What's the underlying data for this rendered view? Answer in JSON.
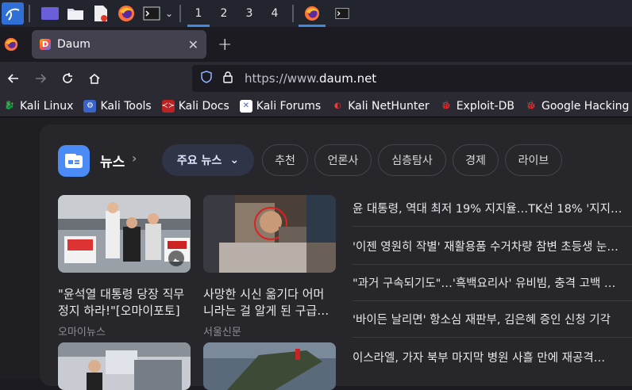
{
  "panel": {
    "workspaces": [
      "1",
      "2",
      "3",
      "4"
    ],
    "active_workspace": "1"
  },
  "browser": {
    "tab_title": "Daum",
    "tab_favicon_letter": "D",
    "url_prefix": "https://www.",
    "url_domain": "daum.net"
  },
  "bookmarks": [
    {
      "label": "Kali Linux",
      "icon": "kali-dragon-icon"
    },
    {
      "label": "Kali Tools",
      "icon": "kali-tools-icon"
    },
    {
      "label": "Kali Docs",
      "icon": "kali-docs-icon"
    },
    {
      "label": "Kali Forums",
      "icon": "kali-forums-icon"
    },
    {
      "label": "Kali NetHunter",
      "icon": "nethunter-icon"
    },
    {
      "label": "Exploit-DB",
      "icon": "exploitdb-icon"
    },
    {
      "label": "Google Hacking DB",
      "icon": "ghdb-icon"
    }
  ],
  "news": {
    "section_title": "뉴스",
    "tabs": [
      {
        "label": "주요 뉴스"
      },
      {
        "label": "추천"
      },
      {
        "label": "언론사"
      },
      {
        "label": "심층탐사"
      },
      {
        "label": "경제"
      },
      {
        "label": "라이브"
      }
    ],
    "cards": [
      {
        "caption_line1": "\"윤석열 대통령 당장 직무",
        "caption_line2": "정지 하라!\"[오마이포토]",
        "source": "오마이뉴스"
      },
      {
        "caption_line1": "사망한 시신 옮기다 어머",
        "caption_line2": "니라는 걸 알게 된 구급…",
        "source": "서울신문"
      }
    ],
    "headlines": [
      "윤 대통령, 역대 최저 19% 지지율…TK선 18% '지지…",
      "'이젠 영원히 작별' 재활용품 수거차량 참변 초등생 눈…",
      "\"과거 구속되기도\"…'흑백요리사' 유비빔, 충격 고백 …",
      "'바이든 날리면' 항소심 재판부, 김은혜 증인 신청 기각",
      "이스라엘, 가자 북부 마지막 병원 사흘 만에 재공격…"
    ]
  }
}
